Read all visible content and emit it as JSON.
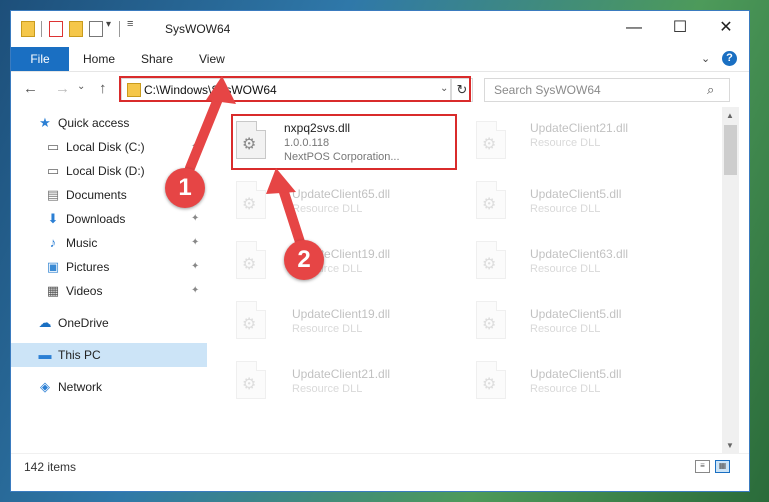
{
  "window": {
    "title": "SysWOW64",
    "minimize": "—",
    "maximize": "☐",
    "close": "✕"
  },
  "ribbon": {
    "tabs": [
      "File",
      "Home",
      "Share",
      "View"
    ],
    "collapse": "⌄",
    "help": "?"
  },
  "navigation": {
    "back": "←",
    "forward": "→",
    "recent": "⌄",
    "up": "↑",
    "address": "C:\\Windows\\SysWOW64",
    "address_dropdown": "⌄",
    "refresh": "↻",
    "search_placeholder": "Search SysWOW64",
    "search_icon": "⌕"
  },
  "sidebar": {
    "items": [
      {
        "label": "Quick access",
        "icon": "★",
        "pinned": false
      },
      {
        "label": "Local Disk (C:)",
        "icon": "▭",
        "pinned": true
      },
      {
        "label": "Local Disk (D:)",
        "icon": "▭",
        "pinned": false
      },
      {
        "label": "Documents",
        "icon": "▤",
        "pinned": true
      },
      {
        "label": "Downloads",
        "icon": "⬇",
        "pinned": true
      },
      {
        "label": "Music",
        "icon": "♪",
        "pinned": true
      },
      {
        "label": "Pictures",
        "icon": "▣",
        "pinned": true
      },
      {
        "label": "Videos",
        "icon": "▦",
        "pinned": true
      },
      {
        "label": "OneDrive",
        "icon": "☁",
        "pinned": false
      },
      {
        "label": "This PC",
        "icon": "▬",
        "pinned": false
      },
      {
        "label": "Network",
        "icon": "◈",
        "pinned": false
      }
    ],
    "pin_icon": "📌"
  },
  "files": {
    "highlighted": {
      "name": "nxpq2svs.dll",
      "version": "1.0.0.118",
      "company": "NextPOS Corporation..."
    },
    "others": [
      {
        "name": "UpdateClient21.dll",
        "desc": "Resource DLL"
      },
      {
        "name": "UpdateClient65.dll",
        "desc": "Resource DLL"
      },
      {
        "name": "UpdateClient5.dll",
        "desc": "Resource DLL"
      },
      {
        "name": "UpdateClient19.dll",
        "desc": "Resource DLL"
      },
      {
        "name": "UpdateClient63.dll",
        "desc": "Resource DLL"
      },
      {
        "name": "UpdateClient19.dll",
        "desc": "Resource DLL"
      },
      {
        "name": "UpdateClient5.dll",
        "desc": "Resource DLL"
      },
      {
        "name": "UpdateClient21.dll",
        "desc": "Resource DLL"
      },
      {
        "name": "UpdateClient5.dll",
        "desc": "Resource DLL"
      }
    ],
    "icon_glyph": "⚙"
  },
  "status": {
    "count": "142 items"
  },
  "callouts": {
    "one": "1",
    "two": "2"
  },
  "colors": {
    "accent": "#1a6fc2",
    "highlight": "#d92b2b",
    "callout": "#e64545",
    "selected": "#cce4f7"
  }
}
